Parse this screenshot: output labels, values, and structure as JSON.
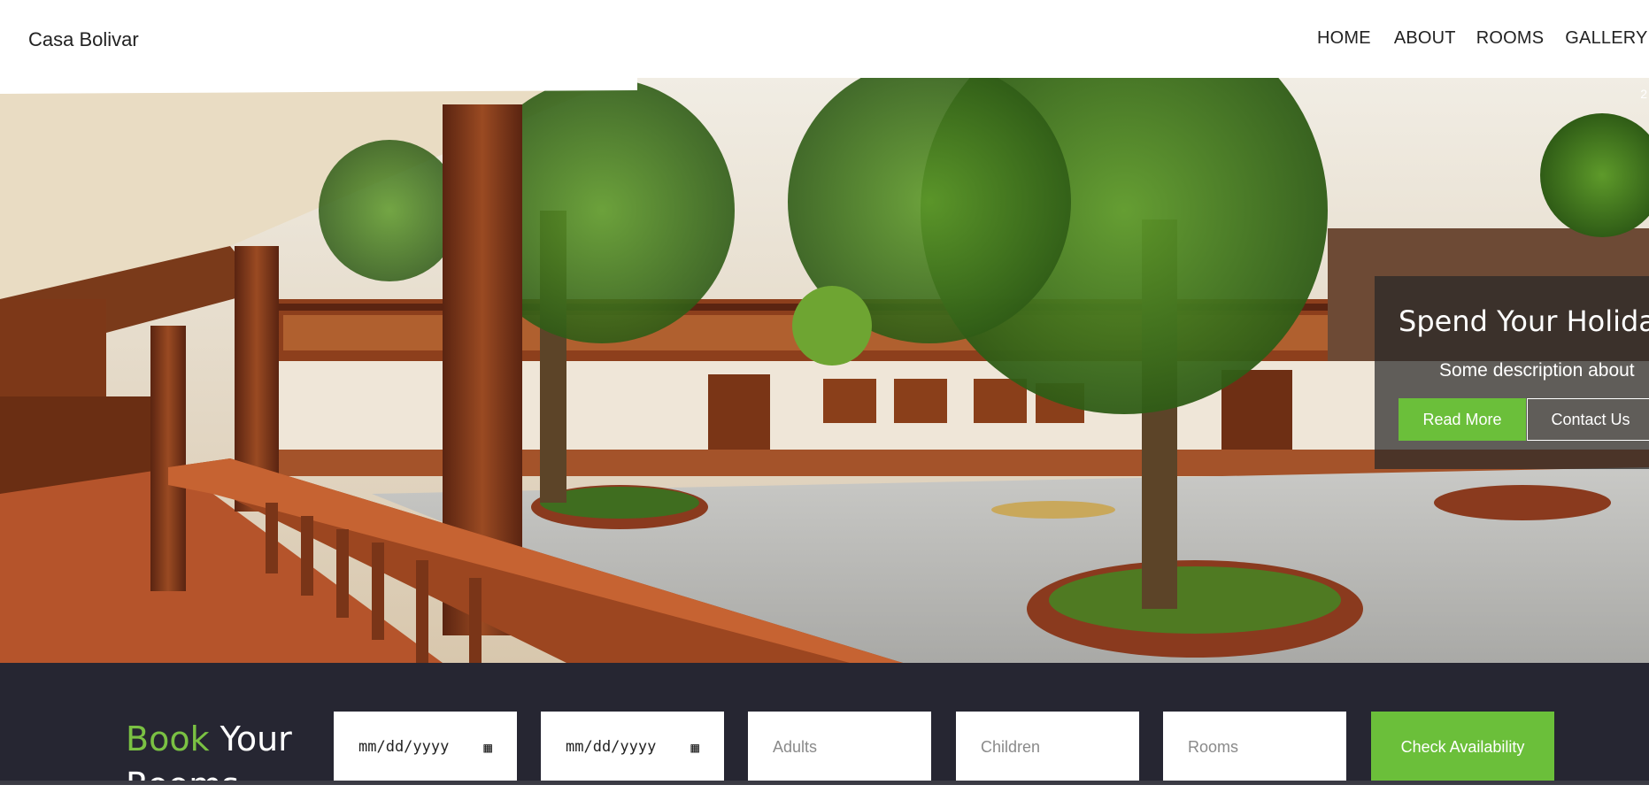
{
  "navbar": {
    "brand": "Casa Bolivar",
    "links": [
      "HOME",
      "ABOUT",
      "ROOMS",
      "GALLERY"
    ]
  },
  "hero": {
    "slide_counter": "2",
    "title": "Spend Your Holiday",
    "description": "Some description about",
    "read_more_label": "Read More",
    "contact_label": "Contact Us",
    "image": "hotel-courtyard-photo"
  },
  "booking": {
    "title_accent": "Book",
    "title_rest": "Your",
    "title_line2": "Rooms",
    "checkin_placeholder": "mm/dd/yyyy",
    "checkout_placeholder": "mm/dd/yyyy",
    "adults_placeholder": "Adults",
    "children_placeholder": "Children",
    "rooms_placeholder": "Rooms",
    "check_label": "Check Availability"
  },
  "colors": {
    "accent_green": "#6bbf3a",
    "booking_bg": "#262632",
    "nav_text": "#222222"
  }
}
